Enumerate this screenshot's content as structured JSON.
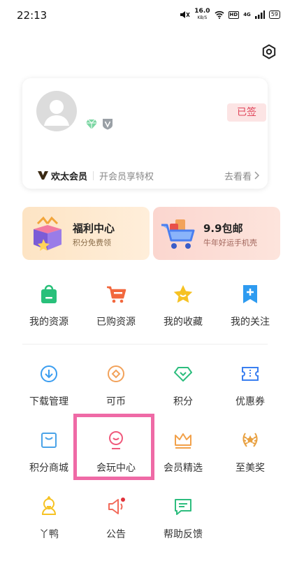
{
  "status_bar": {
    "time": "22:13",
    "net_speed": "16.0",
    "net_unit": "KB/S",
    "hd": "HD",
    "signal": "4G",
    "battery": "59"
  },
  "profile_card": {
    "signed_label": "已签",
    "vip_name": "欢太会员",
    "vip_promo": "开会员享特权",
    "vip_link": "去看看"
  },
  "banners": [
    {
      "title": "福利中心",
      "subtitle": "积分免费领"
    },
    {
      "title": "9.9包邮",
      "subtitle": "牛年好运手机壳"
    }
  ],
  "row1": [
    {
      "label": "我的资源",
      "icon": "bag-icon",
      "color": "#28c07a"
    },
    {
      "label": "已购资源",
      "icon": "cart-icon",
      "color": "#f2683e"
    },
    {
      "label": "我的收藏",
      "icon": "star-icon",
      "color": "#f6c223"
    },
    {
      "label": "我的关注",
      "icon": "bookmark-plus-icon",
      "color": "#2e9bf0"
    }
  ],
  "row2": [
    {
      "label": "下载管理",
      "icon": "download-icon",
      "color": "#3a9df0"
    },
    {
      "label": "可币",
      "icon": "coin-icon",
      "color": "#f2a25a"
    },
    {
      "label": "积分",
      "icon": "diamond-icon",
      "color": "#2dbd7e"
    },
    {
      "label": "优惠券",
      "icon": "ticket-icon",
      "color": "#3a7ff0"
    }
  ],
  "row3": [
    {
      "label": "积分商城",
      "icon": "store-icon",
      "color": "#4aa3e8"
    },
    {
      "label": "会玩中心",
      "icon": "medal-icon",
      "color": "#f05a7c"
    },
    {
      "label": "会员精选",
      "icon": "crown-icon",
      "color": "#f2a14a"
    },
    {
      "label": "至美奖",
      "icon": "laurel-icon",
      "color": "#e8a040"
    }
  ],
  "row4": [
    {
      "label": "丫鸭",
      "icon": "duck-icon",
      "color": "#f6c223"
    },
    {
      "label": "公告",
      "icon": "megaphone-icon",
      "color": "#f26a5a"
    },
    {
      "label": "帮助反馈",
      "icon": "chat-icon",
      "color": "#2dbd7e"
    }
  ]
}
